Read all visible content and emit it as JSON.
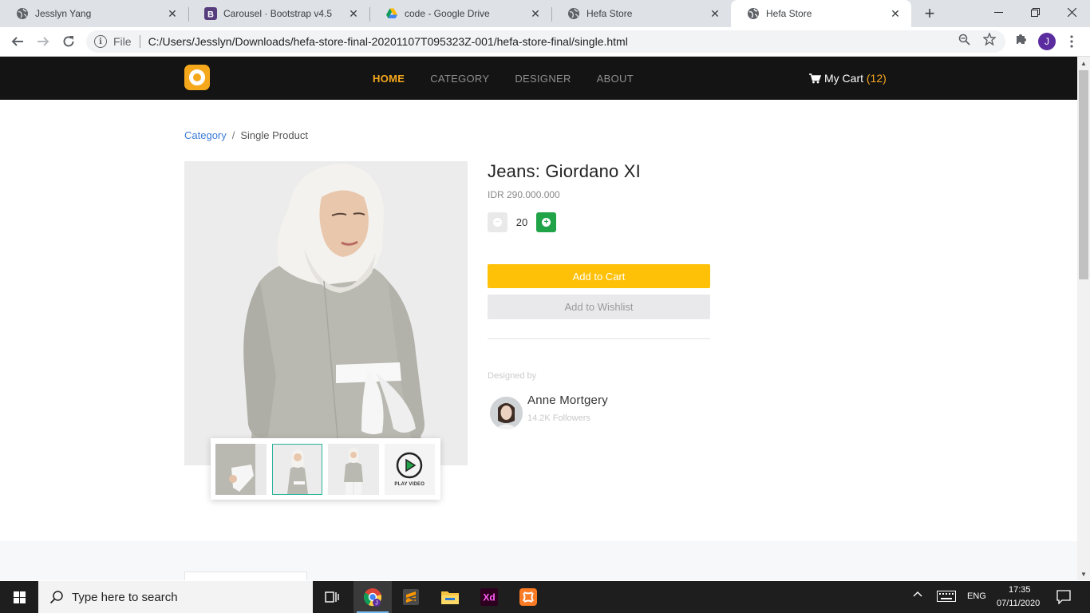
{
  "browser": {
    "tabs": [
      {
        "title": "Jesslyn Yang",
        "icon": "globe-icon"
      },
      {
        "title": "Carousel · Bootstrap v4.5",
        "icon": "bootstrap-icon"
      },
      {
        "title": "code - Google Drive",
        "icon": "google-drive-icon"
      },
      {
        "title": "Hefa Store",
        "icon": "globe-icon"
      },
      {
        "title": "Hefa Store",
        "icon": "globe-icon",
        "active": true
      }
    ],
    "omnibox": {
      "scheme_label": "File",
      "url": "C:/Users/Jesslyn/Downloads/hefa-store-final-20201107T095323Z-001/hefa-store-final/single.html"
    },
    "profile_initial": "J"
  },
  "site": {
    "nav": {
      "items": [
        "HOME",
        "CATEGORY",
        "DESIGNER",
        "ABOUT"
      ],
      "active": "HOME",
      "cart_label": "My Cart",
      "cart_count": "(12)"
    },
    "breadcrumb": {
      "link": "Category",
      "separator": "/",
      "current": "Single Product"
    },
    "product": {
      "title": "Jeans: Giordano XI",
      "price": "IDR 290.000.000",
      "quantity": "20",
      "add_to_cart": "Add to Cart",
      "add_to_wishlist": "Add to Wishlist",
      "thumbnails_selected_index": 1,
      "play_video_label": "PLAY VIDEO"
    },
    "designer": {
      "label": "Designed by",
      "name": "Anne Mortgery",
      "followers": "14.2K Followers"
    },
    "colors": {
      "accent": "#f6a81d",
      "add_to_cart_bg": "#ffc107",
      "plus_button": "#21a348",
      "navbar_bg": "#141414",
      "link": "#3a7bd5"
    }
  },
  "taskbar": {
    "search_placeholder": "Type here to search",
    "apps": [
      "chrome-icon",
      "sublime-text-icon",
      "file-explorer-icon",
      "adobe-xd-icon",
      "xampp-icon"
    ],
    "language": "ENG",
    "time": "17:35",
    "date": "07/11/2020"
  }
}
